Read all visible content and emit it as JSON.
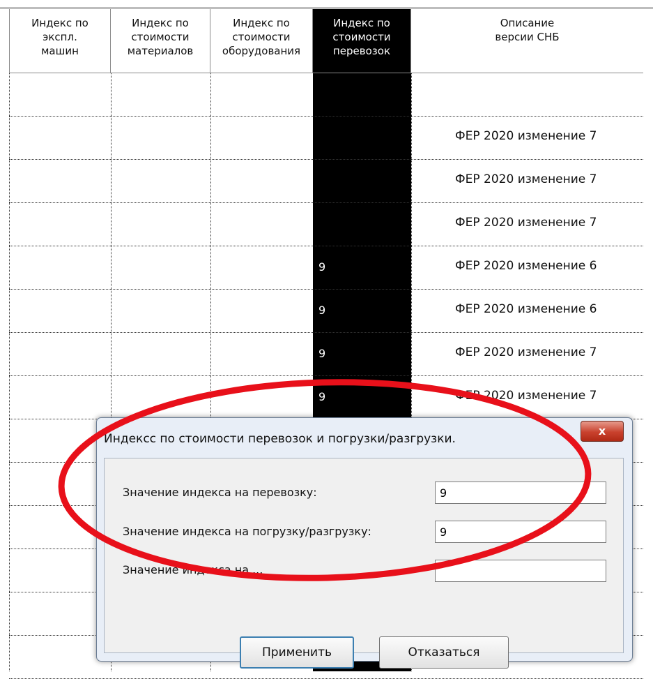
{
  "columns": [
    {
      "title": "Индекс по\nэкспл.\nмашин"
    },
    {
      "title": "Индекс по\nстоимости\nматериалов"
    },
    {
      "title": "Индекс по\nстоимости\nоборудования"
    },
    {
      "title": "Индекс по\nстоимости\nперевозок"
    },
    {
      "title": "Описание\nверсии СНБ"
    }
  ],
  "rows": [
    {
      "transport_index": "",
      "description": ""
    },
    {
      "transport_index": "",
      "description": "ФЕР 2020 изменение 7"
    },
    {
      "transport_index": "",
      "description": "ФЕР 2020 изменение 7"
    },
    {
      "transport_index": "",
      "description": "ФЕР 2020 изменение 7"
    },
    {
      "transport_index": "9",
      "description": "ФЕР 2020 изменение 6"
    },
    {
      "transport_index": "9",
      "description": "ФЕР 2020 изменение 6"
    },
    {
      "transport_index": "9",
      "description": "ФЕР 2020 изменение 7"
    },
    {
      "transport_index": "9",
      "description": "ФЕР 2020 изменение 7"
    }
  ],
  "dialog": {
    "title": "Индексс по стоимости перевозок и погрузки/разгрузки.",
    "close_label": "x",
    "fields": [
      {
        "label": "Значение индекса на перевозку:",
        "value": "9"
      },
      {
        "label": "Значение индекса на погрузку/разгрузку:",
        "value": "9"
      },
      {
        "label": "Значение индекса на ...",
        "value": ""
      }
    ],
    "apply_label": "Применить",
    "cancel_label": "Отказаться"
  },
  "colors": {
    "selected_column": "#000000",
    "annotation": "#e8101a",
    "close_button": "#c9412d"
  }
}
